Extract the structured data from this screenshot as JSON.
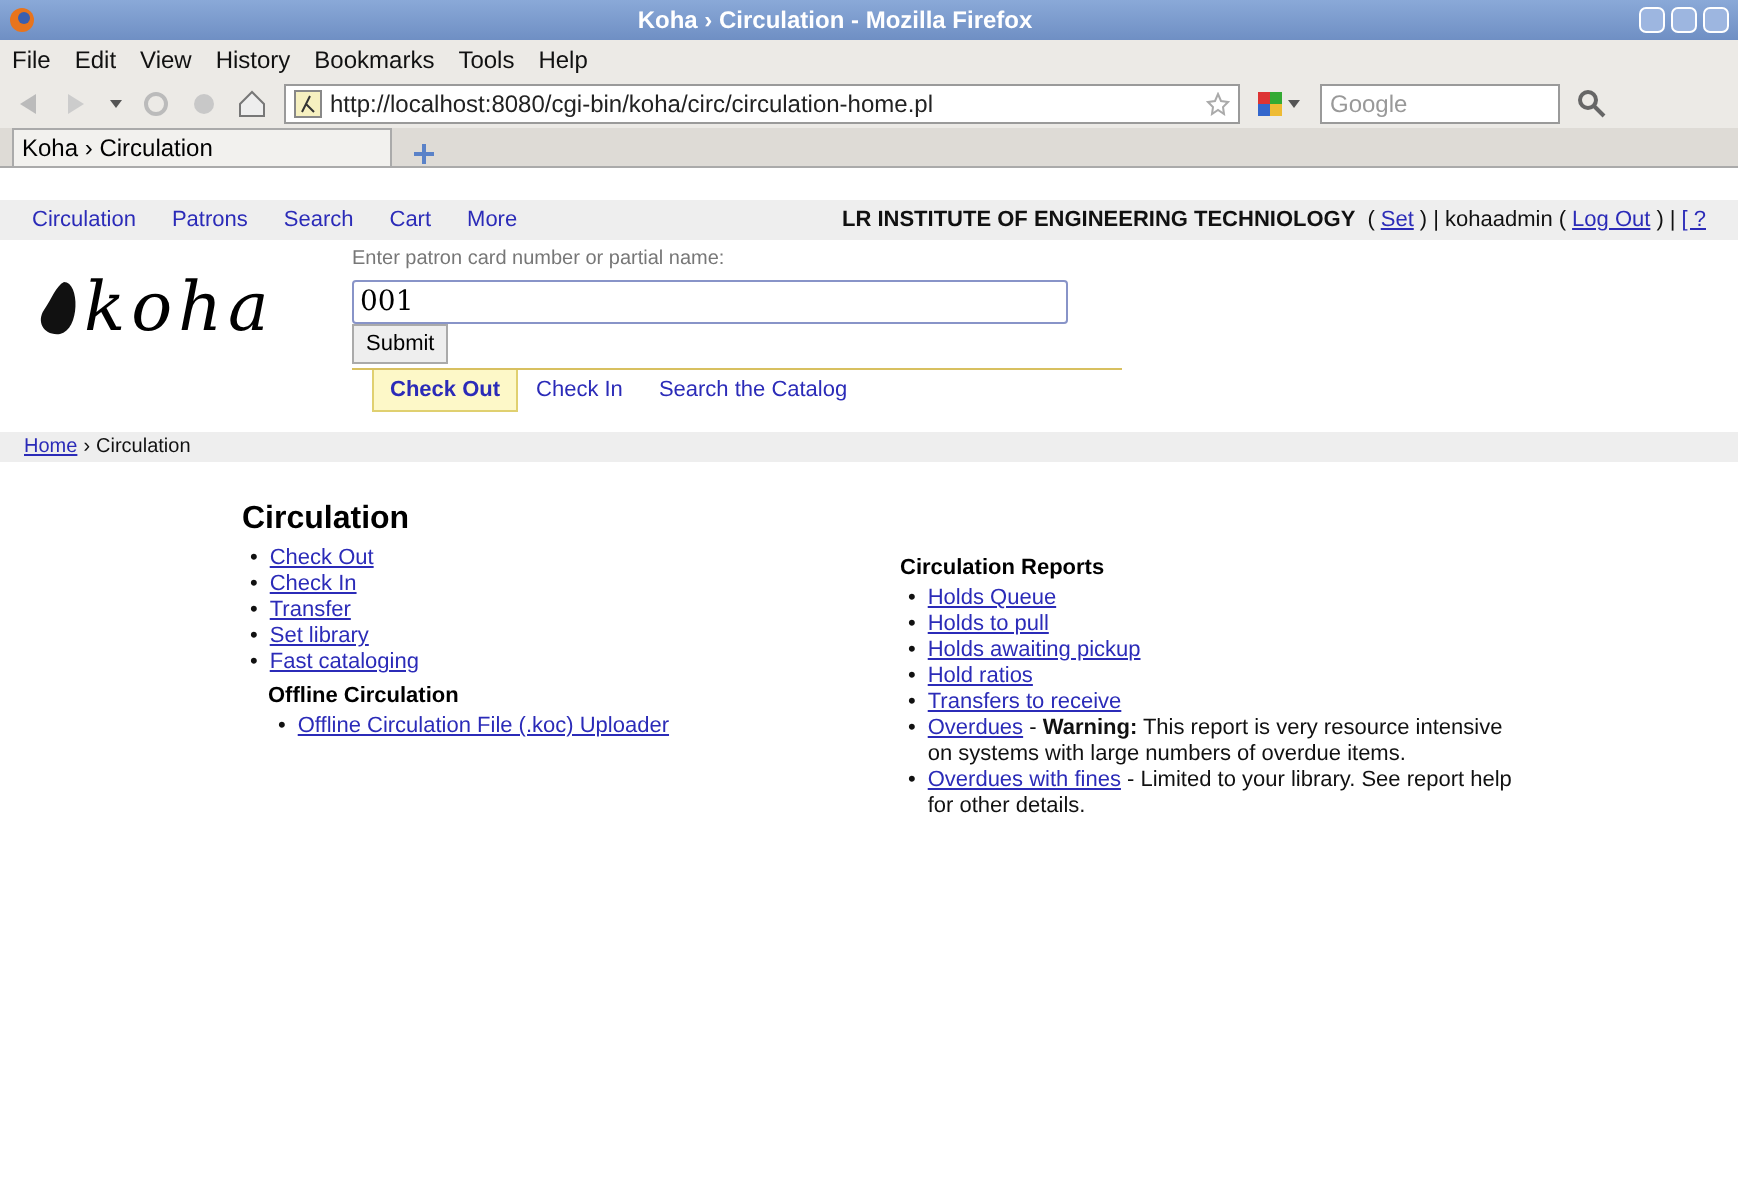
{
  "window": {
    "title": "Koha › Circulation - Mozilla Firefox"
  },
  "menu": [
    "File",
    "Edit",
    "View",
    "History",
    "Bookmarks",
    "Tools",
    "Help"
  ],
  "address_bar": {
    "url": "http://localhost:8080/cgi-bin/koha/circ/circulation-home.pl"
  },
  "search_bar": {
    "placeholder": "Google"
  },
  "browser_tabs": [
    {
      "label": "Koha › Circulation",
      "selected": true
    }
  ],
  "koha_nav": {
    "links": [
      "Circulation",
      "Patrons",
      "Search",
      "Cart",
      "More"
    ],
    "library": "LR INSTITUTE OF ENGINEERING TECHNIOLOGY",
    "user_parts": [
      {
        "kind": "text",
        "text": "("
      },
      {
        "kind": "link",
        "text": "Set"
      },
      {
        "kind": "text",
        "text": ") | kohaadmin ("
      },
      {
        "kind": "link",
        "text": "Log Out"
      },
      {
        "kind": "text",
        "text": ") |"
      },
      {
        "kind": "link",
        "text": "[ ?"
      }
    ]
  },
  "logo": "koha",
  "checkout_form": {
    "label": "Enter patron card number or partial name:",
    "value": "001",
    "submit": "Submit"
  },
  "form_tabs": [
    {
      "label": "Check Out",
      "selected": true
    },
    {
      "label": "Check In",
      "selected": false
    },
    {
      "label": "Search the Catalog",
      "selected": false
    }
  ],
  "breadcrumb": {
    "home": "Home",
    "separator": "›",
    "current": "Circulation"
  },
  "heading": "Circulation",
  "circulation_links": [
    {
      "bullet": "•",
      "label": "Check Out"
    },
    {
      "bullet": "•",
      "label": "Check In"
    },
    {
      "bullet": "•",
      "label": "Transfer"
    },
    {
      "bullet": "•",
      "label": "Set library"
    },
    {
      "bullet": "•",
      "label": "Fast cataloging"
    }
  ],
  "offline": {
    "heading": "Offline Circulation",
    "links": [
      {
        "bullet": "•",
        "label": "Offline Circulation File (.koc) Uploader"
      }
    ]
  },
  "reports": {
    "heading": "Circulation Reports",
    "items": [
      {
        "bullet": "•",
        "label": "Holds Queue"
      },
      {
        "bullet": "•",
        "label": "Holds to pull"
      },
      {
        "bullet": "•",
        "label": "Holds awaiting pickup"
      },
      {
        "bullet": "•",
        "label": "Hold ratios"
      },
      {
        "bullet": "•",
        "label": "Transfers to receive"
      },
      {
        "bullet": "•",
        "label": "Overdues",
        "note": "- **Warning:** This report is very resource intensive on systems with large numbers of overdue items."
      },
      {
        "bullet": "•",
        "label": "Overdues with fines",
        "note": "- Limited to your library. See report help for other details."
      }
    ]
  }
}
